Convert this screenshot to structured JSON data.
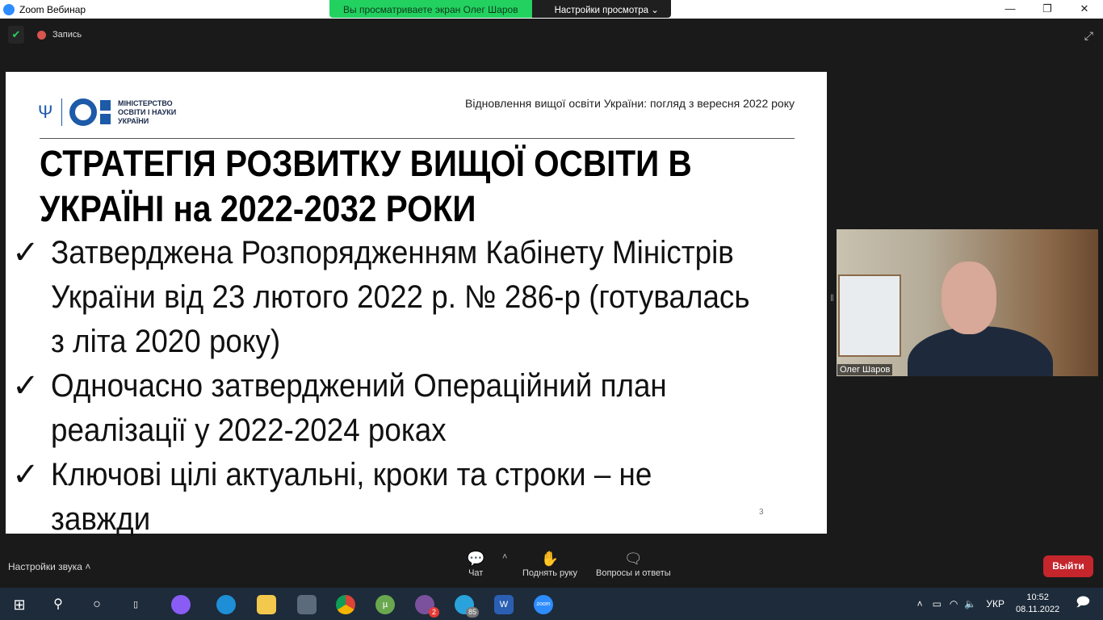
{
  "window": {
    "title": "Zoom Вебинар",
    "viewing_banner": "Вы просматриваете экран Олег Шаров",
    "view_settings": "Настройки просмотра"
  },
  "toolbar_top": {
    "record": "Запись"
  },
  "slide": {
    "header": "Відновлення вищої освіти України: погляд з вересня 2022 року",
    "logo_lines": [
      "МІНІСТЕРСТВО",
      "ОСВІТИ І НАУКИ",
      "УКРАЇНИ"
    ],
    "title_lines": [
      "СТРАТЕГІЯ РОЗВИТКУ ВИЩОЇ ОСВІТИ В",
      "УКРАЇНІ на 2022-2032 РОКИ"
    ],
    "bullets": [
      [
        "Затверджена Розпорядженням Кабінету Міністрів",
        "України від 23 лютого 2022 р. № 286-р (готувалась",
        "з літа 2020 року)"
      ],
      [
        "Одночасно затверджений Операційний план",
        "реалізації у 2022-2024 роках"
      ],
      [
        "Ключові цілі актуальні, кроки та строки – не завжди"
      ]
    ],
    "check": "✓",
    "page": "3"
  },
  "video": {
    "name": "Олег Шаров"
  },
  "bottom": {
    "audio": "Настройки звука",
    "chat": "Чат",
    "raise_hand": "Поднять руку",
    "qa": "Вопросы и ответы",
    "exit": "Выйти"
  },
  "taskbar": {
    "viber_badge": "2",
    "telegram_badge": "85",
    "zoom_label": "zoom",
    "lang": "УКР",
    "time": "10:52",
    "date": "08.11.2022"
  }
}
